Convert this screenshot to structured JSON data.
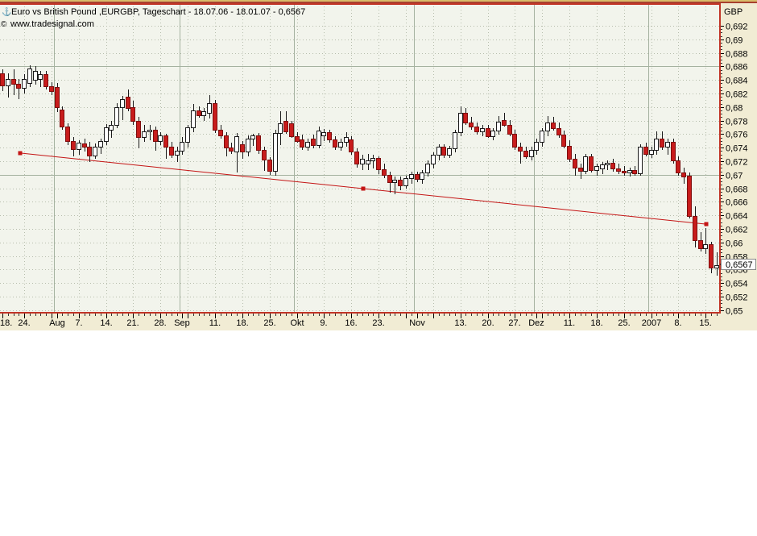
{
  "header": {
    "line1": "Euro vs British Pound ,EURGBP, Tageschart - 18.07.06 - 18.01.07 - 0,6567",
    "line2": "www.tradesignal.com",
    "icons": {
      "window_glyph": "⚓",
      "copyright_glyph": "©"
    }
  },
  "colors": {
    "panel_margin": "#f1ecd4",
    "plot_bg": "#f2f4ec",
    "border_red": "#c13527",
    "top_strip": "#d9bc6b",
    "top_strip2": "#a8402f",
    "grid_dotted": "#b6bdac",
    "grid_solid": "#a5b2a0",
    "candle_down_fill": "#c81c1c",
    "candle_down_stroke": "#7e0d0d",
    "candle_up_fill": "#ffffff",
    "candle_up_stroke": "#1a1a1a",
    "wick": "#1a1a1a",
    "trendline": "#c41515",
    "text": "#000000",
    "price_box_bg": "#fdfdfd",
    "price_box_border": "#8a8a8a"
  },
  "chart_data": {
    "type": "candlestick",
    "instrument": "Euro vs British Pound",
    "symbol": "EURGBP",
    "timeframe": "Tageschart",
    "date_range": "18.07.06 - 18.01.07",
    "currency_label": "GBP",
    "last_price_value": 0.6567,
    "last_price_label": "0,6567",
    "y_axis": {
      "min": 0.65,
      "max": 0.692,
      "tick_step": 0.002,
      "minor_tick_step": 0.0005,
      "labels": [
        {
          "v": 0.692,
          "t": "0,692"
        },
        {
          "v": 0.69,
          "t": "0,69"
        },
        {
          "v": 0.688,
          "t": "0,688"
        },
        {
          "v": 0.686,
          "t": "0,686"
        },
        {
          "v": 0.684,
          "t": "0,684"
        },
        {
          "v": 0.682,
          "t": "0,682"
        },
        {
          "v": 0.68,
          "t": "0,68"
        },
        {
          "v": 0.678,
          "t": "0,678"
        },
        {
          "v": 0.676,
          "t": "0,676"
        },
        {
          "v": 0.674,
          "t": "0,674"
        },
        {
          "v": 0.672,
          "t": "0,672"
        },
        {
          "v": 0.67,
          "t": "0,67"
        },
        {
          "v": 0.668,
          "t": "0,668"
        },
        {
          "v": 0.666,
          "t": "0,666"
        },
        {
          "v": 0.664,
          "t": "0,664"
        },
        {
          "v": 0.662,
          "t": "0,662"
        },
        {
          "v": 0.66,
          "t": "0,66"
        },
        {
          "v": 0.658,
          "t": "0,658"
        },
        {
          "v": 0.656,
          "t": "0,656"
        },
        {
          "v": 0.654,
          "t": "0,654"
        },
        {
          "v": 0.652,
          "t": "0,652"
        },
        {
          "v": 0.65,
          "t": "0,65"
        }
      ],
      "major_solid_lines": [
        0.686,
        0.67
      ]
    },
    "x_axis": {
      "labels": [
        {
          "text": "18.",
          "i": 0
        },
        {
          "text": "24.",
          "i": 4
        },
        {
          "text": "Aug",
          "i": 10
        },
        {
          "text": "7.",
          "i": 14
        },
        {
          "text": "14.",
          "i": 19
        },
        {
          "text": "21.",
          "i": 24
        },
        {
          "text": "28.",
          "i": 29
        },
        {
          "text": "Sep",
          "i": 33
        },
        {
          "text": "11.",
          "i": 39
        },
        {
          "text": "18.",
          "i": 44
        },
        {
          "text": "25.",
          "i": 49
        },
        {
          "text": "Okt",
          "i": 54
        },
        {
          "text": "9.",
          "i": 59
        },
        {
          "text": "16.",
          "i": 64
        },
        {
          "text": "23.",
          "i": 69
        },
        {
          "text": "Nov",
          "i": 76
        },
        {
          "text": "13.",
          "i": 84
        },
        {
          "text": "20.",
          "i": 89
        },
        {
          "text": "27.",
          "i": 94
        },
        {
          "text": "Dez",
          "i": 98
        },
        {
          "text": "11.",
          "i": 104
        },
        {
          "text": "18.",
          "i": 109
        },
        {
          "text": "25.",
          "i": 114
        },
        {
          "text": "2007",
          "i": 119
        },
        {
          "text": "8.",
          "i": 124
        },
        {
          "text": "15.",
          "i": 129
        }
      ],
      "week_line_indices": [
        4,
        9,
        14,
        19,
        24,
        29,
        34,
        39,
        44,
        49,
        54,
        59,
        64,
        69,
        74,
        79,
        84,
        89,
        94,
        99,
        104,
        109,
        114,
        119,
        124,
        129
      ],
      "month_line_indices": [
        9.5,
        32.5,
        53.5,
        75.5,
        97.5,
        118.5
      ]
    },
    "trendline": {
      "start_index": 3.25,
      "start_price": 0.6732,
      "end_index": 129.1,
      "end_price": 0.6627,
      "handles": "square-start-mid-end"
    },
    "candles_format": [
      "open",
      "high",
      "low",
      "close"
    ],
    "candles": [
      [
        0.685,
        0.6856,
        0.6824,
        0.6832
      ],
      [
        0.6832,
        0.685,
        0.6814,
        0.6841
      ],
      [
        0.6841,
        0.6856,
        0.6818,
        0.6834
      ],
      [
        0.6834,
        0.6841,
        0.6812,
        0.6828
      ],
      [
        0.6828,
        0.6848,
        0.682,
        0.6841
      ],
      [
        0.6836,
        0.6862,
        0.683,
        0.6857
      ],
      [
        0.684,
        0.6861,
        0.6833,
        0.6853
      ],
      [
        0.6842,
        0.6853,
        0.683,
        0.6848
      ],
      [
        0.6848,
        0.6853,
        0.6826,
        0.6831
      ],
      [
        0.6831,
        0.6837,
        0.6818,
        0.6824
      ],
      [
        0.683,
        0.6836,
        0.6793,
        0.68
      ],
      [
        0.6796,
        0.6801,
        0.6767,
        0.6771
      ],
      [
        0.6771,
        0.6776,
        0.6744,
        0.675
      ],
      [
        0.675,
        0.6756,
        0.6727,
        0.6738
      ],
      [
        0.6738,
        0.6751,
        0.673,
        0.6747
      ],
      [
        0.6746,
        0.6753,
        0.6734,
        0.6741
      ],
      [
        0.6741,
        0.6748,
        0.6719,
        0.6728
      ],
      [
        0.6728,
        0.6746,
        0.6724,
        0.6741
      ],
      [
        0.6741,
        0.6753,
        0.6731,
        0.675
      ],
      [
        0.675,
        0.6775,
        0.6744,
        0.677
      ],
      [
        0.6766,
        0.6779,
        0.6755,
        0.6774
      ],
      [
        0.6774,
        0.6806,
        0.6769,
        0.68
      ],
      [
        0.68,
        0.6816,
        0.6781,
        0.6812
      ],
      [
        0.6815,
        0.6826,
        0.6794,
        0.6798
      ],
      [
        0.68,
        0.6809,
        0.6774,
        0.6779
      ],
      [
        0.6779,
        0.6786,
        0.6739,
        0.6756
      ],
      [
        0.6756,
        0.6773,
        0.6749,
        0.6764
      ],
      [
        0.6764,
        0.6773,
        0.6751,
        0.6766
      ],
      [
        0.6766,
        0.6771,
        0.6735,
        0.675
      ],
      [
        0.675,
        0.6763,
        0.6744,
        0.6758
      ],
      [
        0.6758,
        0.6761,
        0.6723,
        0.6742
      ],
      [
        0.6742,
        0.6748,
        0.6725,
        0.673
      ],
      [
        0.673,
        0.6741,
        0.6719,
        0.6736
      ],
      [
        0.6736,
        0.6756,
        0.6729,
        0.6749
      ],
      [
        0.6749,
        0.6773,
        0.674,
        0.677
      ],
      [
        0.677,
        0.6805,
        0.6763,
        0.6795
      ],
      [
        0.6795,
        0.6801,
        0.6784,
        0.6788
      ],
      [
        0.6788,
        0.6799,
        0.678,
        0.6794
      ],
      [
        0.6791,
        0.6818,
        0.6783,
        0.6806
      ],
      [
        0.6806,
        0.6811,
        0.6762,
        0.6766
      ],
      [
        0.6766,
        0.6773,
        0.6753,
        0.6758
      ],
      [
        0.6758,
        0.6763,
        0.6727,
        0.674
      ],
      [
        0.674,
        0.6747,
        0.6731,
        0.6735
      ],
      [
        0.6734,
        0.6762,
        0.6703,
        0.6757
      ],
      [
        0.6745,
        0.675,
        0.6724,
        0.6734
      ],
      [
        0.6734,
        0.6758,
        0.6727,
        0.6753
      ],
      [
        0.6753,
        0.6761,
        0.6743,
        0.6758
      ],
      [
        0.6758,
        0.6762,
        0.6731,
        0.6737
      ],
      [
        0.6737,
        0.6742,
        0.6706,
        0.6722
      ],
      [
        0.6722,
        0.6726,
        0.67,
        0.6706
      ],
      [
        0.6706,
        0.6766,
        0.6699,
        0.6762
      ],
      [
        0.6762,
        0.6794,
        0.6744,
        0.6776
      ],
      [
        0.6779,
        0.6794,
        0.6761,
        0.6764
      ],
      [
        0.6776,
        0.6779,
        0.6754,
        0.6757
      ],
      [
        0.6757,
        0.6763,
        0.6747,
        0.675
      ],
      [
        0.6752,
        0.6759,
        0.6737,
        0.6741
      ],
      [
        0.6741,
        0.6753,
        0.6735,
        0.6749
      ],
      [
        0.6753,
        0.6759,
        0.6739,
        0.6744
      ],
      [
        0.6744,
        0.6771,
        0.6739,
        0.6765
      ],
      [
        0.6758,
        0.6768,
        0.675,
        0.6763
      ],
      [
        0.6763,
        0.6767,
        0.6747,
        0.6752
      ],
      [
        0.6752,
        0.6757,
        0.6737,
        0.6741
      ],
      [
        0.6741,
        0.6753,
        0.6735,
        0.6749
      ],
      [
        0.6749,
        0.6763,
        0.6741,
        0.6756
      ],
      [
        0.6752,
        0.6757,
        0.6729,
        0.6734
      ],
      [
        0.6734,
        0.6739,
        0.6711,
        0.6717
      ],
      [
        0.6717,
        0.6729,
        0.6707,
        0.6723
      ],
      [
        0.6716,
        0.6731,
        0.6707,
        0.6721
      ],
      [
        0.6721,
        0.6729,
        0.6709,
        0.6725
      ],
      [
        0.6725,
        0.6727,
        0.6701,
        0.6708
      ],
      [
        0.6708,
        0.6717,
        0.6695,
        0.67
      ],
      [
        0.67,
        0.6705,
        0.6674,
        0.6689
      ],
      [
        0.6689,
        0.6697,
        0.6671,
        0.6693
      ],
      [
        0.6693,
        0.6697,
        0.6677,
        0.6684
      ],
      [
        0.6684,
        0.6699,
        0.6679,
        0.6695
      ],
      [
        0.6695,
        0.6705,
        0.6687,
        0.6701
      ],
      [
        0.6701,
        0.6705,
        0.6689,
        0.6694
      ],
      [
        0.6694,
        0.6707,
        0.6687,
        0.6703
      ],
      [
        0.6703,
        0.6721,
        0.6697,
        0.6717
      ],
      [
        0.6717,
        0.6733,
        0.6709,
        0.6729
      ],
      [
        0.6729,
        0.6745,
        0.6721,
        0.6741
      ],
      [
        0.6741,
        0.6745,
        0.6725,
        0.673
      ],
      [
        0.673,
        0.6743,
        0.6725,
        0.6739
      ],
      [
        0.6739,
        0.6767,
        0.6733,
        0.6763
      ],
      [
        0.6763,
        0.6801,
        0.6757,
        0.6791
      ],
      [
        0.6791,
        0.6799,
        0.6773,
        0.6777
      ],
      [
        0.6777,
        0.6786,
        0.6767,
        0.6771
      ],
      [
        0.6771,
        0.6777,
        0.6759,
        0.6764
      ],
      [
        0.6764,
        0.6773,
        0.6757,
        0.6769
      ],
      [
        0.6769,
        0.6773,
        0.6754,
        0.6757
      ],
      [
        0.6757,
        0.6769,
        0.6751,
        0.6765
      ],
      [
        0.6765,
        0.6787,
        0.6759,
        0.6778
      ],
      [
        0.6781,
        0.6791,
        0.6771,
        0.6773
      ],
      [
        0.6773,
        0.6781,
        0.6757,
        0.6761
      ],
      [
        0.6761,
        0.6766,
        0.6737,
        0.6741
      ],
      [
        0.6741,
        0.6747,
        0.6716,
        0.6735
      ],
      [
        0.6735,
        0.6741,
        0.6723,
        0.6727
      ],
      [
        0.6727,
        0.6741,
        0.6721,
        0.6737
      ],
      [
        0.6737,
        0.6753,
        0.6729,
        0.6749
      ],
      [
        0.6749,
        0.6769,
        0.6741,
        0.6765
      ],
      [
        0.6765,
        0.6787,
        0.6757,
        0.6777
      ],
      [
        0.6777,
        0.6785,
        0.6765,
        0.6769
      ],
      [
        0.6769,
        0.6777,
        0.6755,
        0.6759
      ],
      [
        0.6759,
        0.6765,
        0.6739,
        0.6743
      ],
      [
        0.6743,
        0.6751,
        0.6719,
        0.6723
      ],
      [
        0.6723,
        0.6731,
        0.6699,
        0.6711
      ],
      [
        0.6711,
        0.6717,
        0.6694,
        0.6706
      ],
      [
        0.6706,
        0.6731,
        0.6701,
        0.6727
      ],
      [
        0.6727,
        0.6731,
        0.6703,
        0.6707
      ],
      [
        0.6707,
        0.6717,
        0.6699,
        0.6713
      ],
      [
        0.6709,
        0.6719,
        0.6701,
        0.6715
      ],
      [
        0.6715,
        0.6721,
        0.6707,
        0.6718
      ],
      [
        0.6718,
        0.6723,
        0.6705,
        0.6709
      ],
      [
        0.6709,
        0.6717,
        0.6701,
        0.6706
      ],
      [
        0.6706,
        0.6713,
        0.6699,
        0.6703
      ],
      [
        0.6703,
        0.6711,
        0.6697,
        0.6707
      ],
      [
        0.6707,
        0.6713,
        0.6699,
        0.6702
      ],
      [
        0.6702,
        0.6745,
        0.6698,
        0.6741
      ],
      [
        0.6741,
        0.6747,
        0.6727,
        0.6731
      ],
      [
        0.6731,
        0.6741,
        0.6725,
        0.6737
      ],
      [
        0.6737,
        0.6764,
        0.6729,
        0.6753
      ],
      [
        0.6753,
        0.6764,
        0.6737,
        0.6741
      ],
      [
        0.6741,
        0.6753,
        0.6729,
        0.6749
      ],
      [
        0.6749,
        0.6753,
        0.6717,
        0.6721
      ],
      [
        0.6721,
        0.6727,
        0.6699,
        0.6703
      ],
      [
        0.6703,
        0.6711,
        0.6687,
        0.6697
      ],
      [
        0.6699,
        0.6703,
        0.6635,
        0.6639
      ],
      [
        0.6639,
        0.6653,
        0.6593,
        0.6603
      ],
      [
        0.6603,
        0.6615,
        0.6587,
        0.6591
      ],
      [
        0.6591,
        0.6621,
        0.6583,
        0.6597
      ],
      [
        0.6597,
        0.6601,
        0.6555,
        0.6563
      ],
      [
        0.6563,
        0.6586,
        0.6551,
        0.6567
      ]
    ]
  }
}
